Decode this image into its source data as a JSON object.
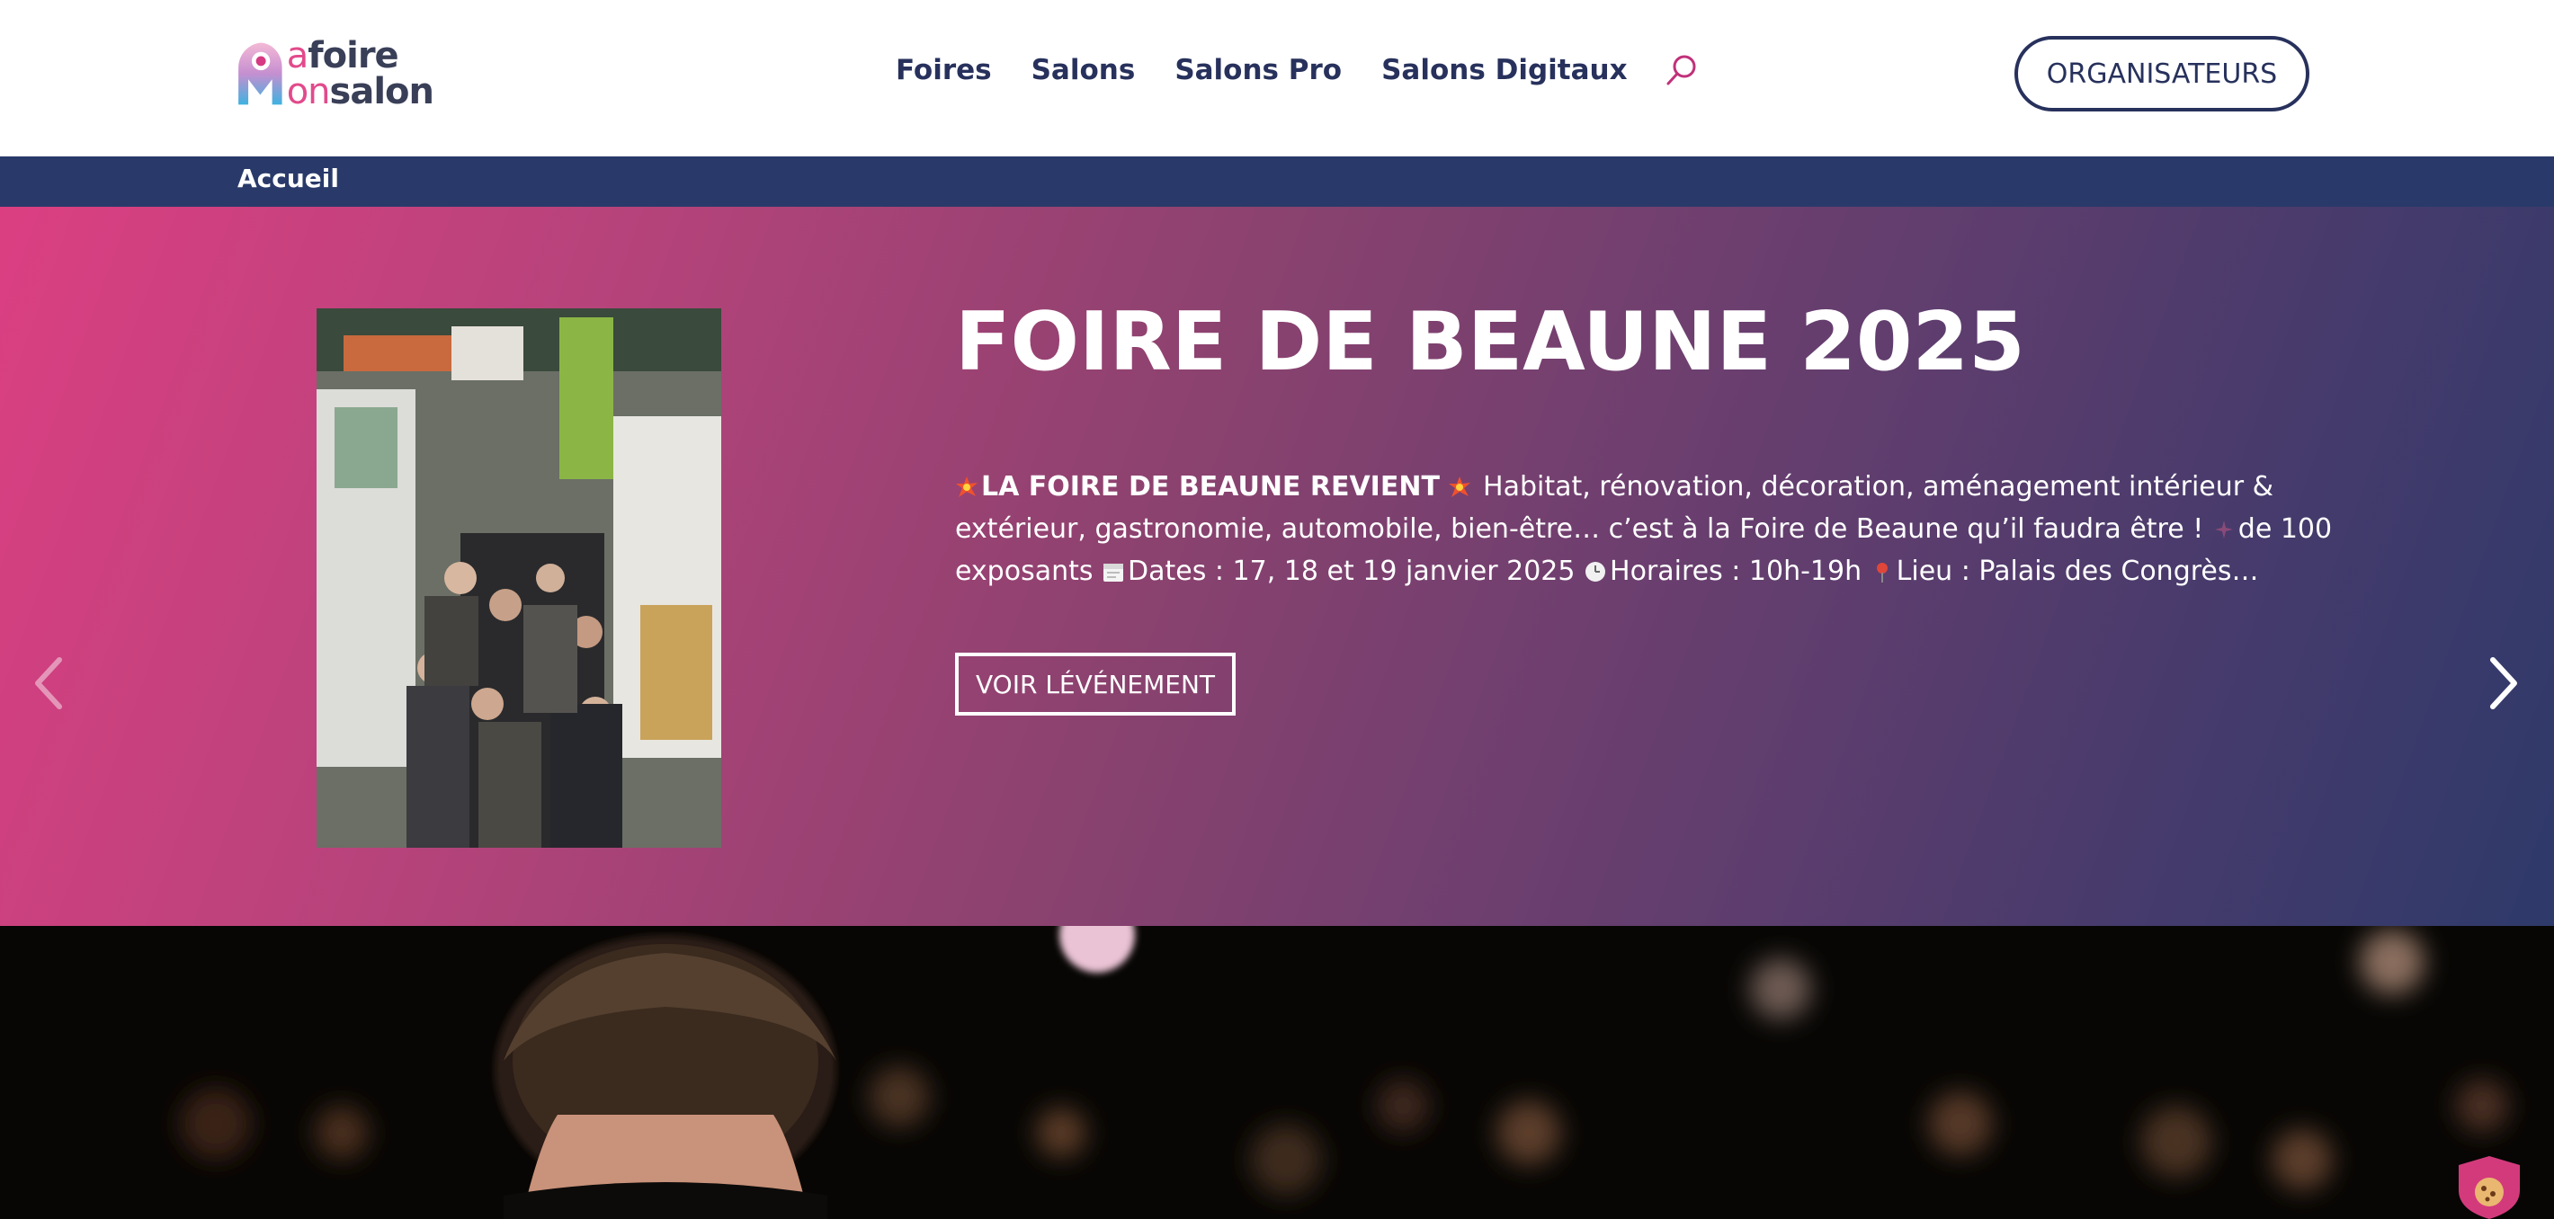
{
  "logo": {
    "line1_light": "a",
    "line1_bold": "foire",
    "line2_light": "on",
    "line2_bold": "salon",
    "alt": "Mafoire Monsalon logo"
  },
  "nav": {
    "items": [
      {
        "label": "Foires"
      },
      {
        "label": "Salons"
      },
      {
        "label": "Salons Pro"
      },
      {
        "label": "Salons Digitaux"
      }
    ],
    "search_icon": "search-icon"
  },
  "header": {
    "organisers_label": "ORGANISATEURS"
  },
  "breadcrumb": {
    "home_label": "Accueil"
  },
  "hero": {
    "title": "FOIRE DE BEAUNE 2025",
    "desc_bold": "LA FOIRE DE BEAUNE REVIENT",
    "desc_part1": " Habitat, rénovation, décoration, aménagement intérieur & extérieur, gastronomie, automobile, bien-être… c’est à la Foire de Beaune qu’il faudra être ! ",
    "desc_part2": "de 100 exposants ",
    "desc_part3": "Dates : 17, 18 et 19 janvier 2025 ",
    "desc_part4": "Horaires : 10h-19h ",
    "desc_part5": "Lieu : Palais des Congrès…",
    "button_label": "VOIR LÉVÉNEMENT",
    "prev_icon": "chevron-left-icon",
    "next_icon": "chevron-right-icon"
  },
  "colors": {
    "navy": "#27315c",
    "breadcrumb_bg": "#293a6a",
    "hero_pink": "#db3f82",
    "hero_navy": "#2e3a6a"
  },
  "cookie_icon": "cookie-icon"
}
